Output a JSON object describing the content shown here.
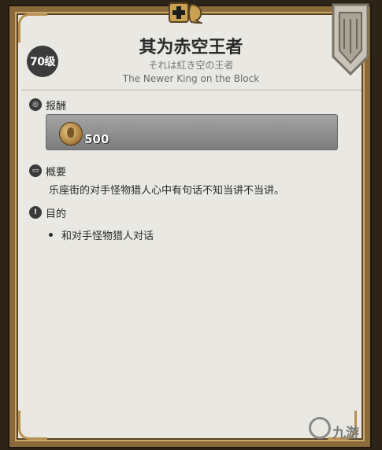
{
  "quest": {
    "level": "70级",
    "title": "其为赤空王者",
    "subtitle_jp": "それは紅き空の王者",
    "subtitle_en": "The Newer King on the Block"
  },
  "sections": {
    "reward": {
      "label": "报酬",
      "amount": "500",
      "icon": "coin-icon"
    },
    "summary": {
      "label": "概要",
      "text": "乐座街的对手怪物猎人心中有句话不知当讲不当讲。",
      "icon": "book-icon"
    },
    "objective": {
      "label": "目的",
      "items": [
        "和对手怪物猎人对话"
      ],
      "icon": "exclamation-icon"
    }
  },
  "watermark": {
    "text": "九游"
  },
  "colors": {
    "panel": "#e9e8e2",
    "frame": "#8a6a3a",
    "badge": "#3b3b3b"
  }
}
